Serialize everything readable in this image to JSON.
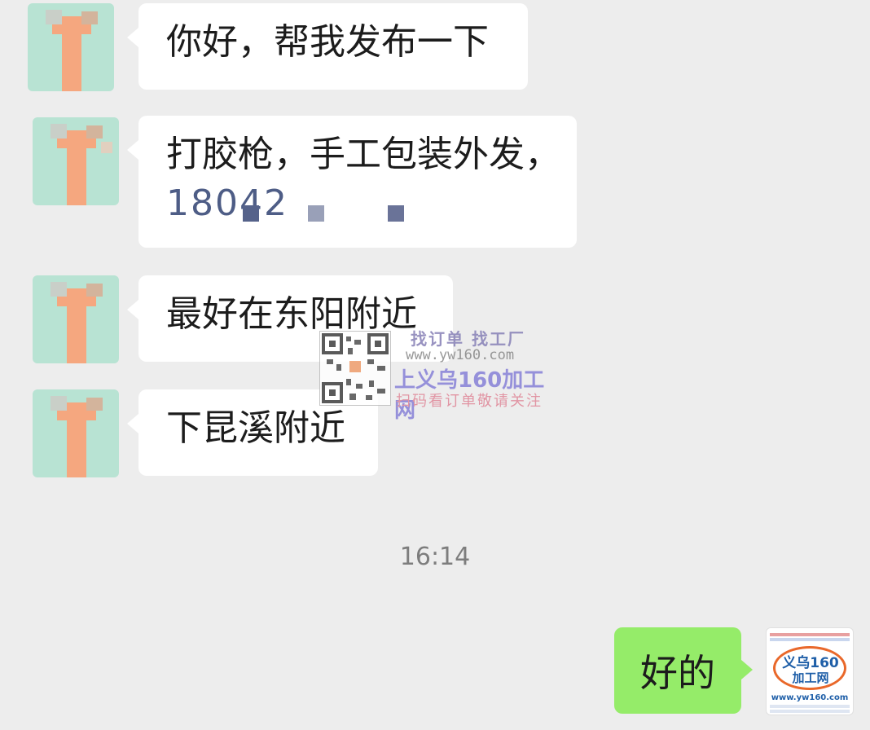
{
  "messages": [
    {
      "sender": "other",
      "text": "你好，帮我发布一下"
    },
    {
      "sender": "other",
      "text": "打胶枪，手工包装外发，",
      "phone": "18042"
    },
    {
      "sender": "other",
      "text": "最好在东阳附近"
    },
    {
      "sender": "other",
      "text": "下昆溪附近"
    }
  ],
  "timestamp": "16:14",
  "reply": {
    "sender": "me",
    "text": "好的"
  },
  "my_avatar": {
    "brand_line1": "义乌160",
    "brand_line2": "加工网",
    "url": "www.yw160.com"
  },
  "watermark": {
    "line1": "找订单 找工厂",
    "line2": "www.yw160.com",
    "line3": "上义乌160加工网",
    "line4": "扫码看订单敬请关注"
  },
  "colors": {
    "background": "#ededed",
    "my_bubble": "#95ec69",
    "their_bubble": "#ffffff",
    "phone_text": "#4e5d86"
  }
}
